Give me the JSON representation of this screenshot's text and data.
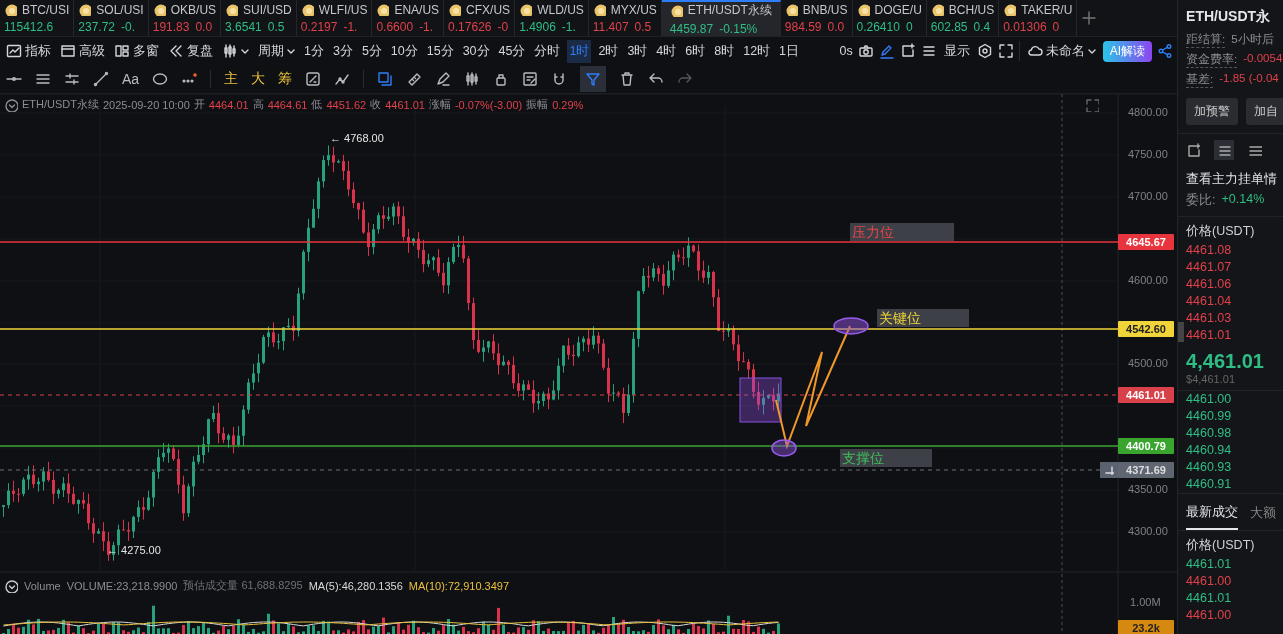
{
  "tickers": [
    {
      "symbol": "BTC/USI",
      "price": "115412.6",
      "up": true,
      "selected": false
    },
    {
      "symbol": "SOL/USI",
      "price": "237.72",
      "change": "-0.",
      "up": true,
      "selected": false
    },
    {
      "symbol": "OKB/US",
      "price": "191.83",
      "change": "0.0",
      "up": false,
      "selected": false
    },
    {
      "symbol": "SUI/USD",
      "price": "3.6541",
      "change": "0.5",
      "up": true,
      "selected": false
    },
    {
      "symbol": "WLFI/US",
      "price": "0.2197",
      "change": "-1.",
      "up": false,
      "selected": false
    },
    {
      "symbol": "ENA/US",
      "price": "0.6600",
      "change": "-1.",
      "up": false,
      "selected": false
    },
    {
      "symbol": "CFX/US",
      "price": "0.17626",
      "change": "-0",
      "up": false,
      "selected": false
    },
    {
      "symbol": "WLD/US",
      "price": "1.4906",
      "change": "-1.",
      "up": true,
      "selected": false
    },
    {
      "symbol": "MYX/US",
      "price": "11.407",
      "change": "0.5",
      "up": false,
      "selected": false
    },
    {
      "symbol": "ETH/USDT永续",
      "price": "4459.87",
      "change": "-0.15%",
      "up": true,
      "selected": true
    },
    {
      "symbol": "BNB/US",
      "price": "984.59",
      "change": "0.0",
      "up": false,
      "selected": false
    },
    {
      "symbol": "DOGE/U",
      "price": "0.26410",
      "change": "0",
      "up": true,
      "selected": false
    },
    {
      "symbol": "BCH/US",
      "price": "602.85",
      "change": "0.4",
      "up": true,
      "selected": false
    },
    {
      "symbol": "TAKER/U",
      "price": "0.01306",
      "change": "0",
      "up": false,
      "selected": false
    }
  ],
  "toolbar": {
    "tools": [
      "指标",
      "高级",
      "多窗",
      "复盘"
    ],
    "period_label": "周期",
    "intervals": [
      {
        "label": "1分",
        "selected": false
      },
      {
        "label": "3分",
        "selected": false
      },
      {
        "label": "5分",
        "selected": false
      },
      {
        "label": "10分",
        "selected": false
      },
      {
        "label": "15分",
        "selected": false
      },
      {
        "label": "30分",
        "selected": false
      },
      {
        "label": "45分",
        "selected": false
      },
      {
        "label": "分时",
        "selected": false
      },
      {
        "label": "1时",
        "selected": true
      },
      {
        "label": "2时",
        "selected": false
      },
      {
        "label": "3时",
        "selected": false
      },
      {
        "label": "4时",
        "selected": false
      },
      {
        "label": "6时",
        "selected": false
      },
      {
        "label": "8时",
        "selected": false
      },
      {
        "label": "12时",
        "selected": false
      },
      {
        "label": "1日",
        "selected": false
      }
    ],
    "countdown": "0s",
    "display_label": "显示",
    "layout_name": "未命名",
    "ai_button": "AI解读"
  },
  "draw_toolbar": {
    "text_tool": "Aa",
    "indicator_buttons": [
      "主",
      "大",
      "筹"
    ],
    "tools": [
      {
        "selected": false
      },
      {
        "selected": false
      },
      {
        "selected": false
      },
      {
        "selected": false
      },
      {
        "selected": false
      },
      {
        "selected": false
      },
      {
        "selected": false
      },
      {
        "selected": true
      },
      {
        "selected": false
      },
      {
        "selected": false
      },
      {
        "selected": false
      }
    ]
  },
  "info": {
    "symbol": "ETH/USDT永续",
    "time": "2025-09-20 10:00",
    "negative": true,
    "fields": [
      {
        "label": "开",
        "value": "4464.01"
      },
      {
        "label": "高",
        "value": "4464.61"
      },
      {
        "label": "低",
        "value": "4451.62"
      },
      {
        "label": "收",
        "value": "4461.01"
      },
      {
        "label": "涨幅",
        "value": "-0.07%(-3.00)"
      },
      {
        "label": "振幅",
        "value": "0.29%"
      }
    ]
  },
  "chart": {
    "y_ticks": [
      "4800.00",
      "4750.00",
      "4700.00",
      "4600.00",
      "4500.00",
      "4350.00",
      "4300.00"
    ],
    "high_label": "← 4768.00",
    "low_label": "← 4275.00",
    "zones": [
      {
        "label": "压力位",
        "kind": "resistance"
      },
      {
        "label": "关键位",
        "kind": "key"
      },
      {
        "label": "支撑位",
        "kind": "support"
      }
    ],
    "price_tags": [
      {
        "value": "4645.67",
        "kind": "resistance"
      },
      {
        "value": "4542.60",
        "kind": "key"
      },
      {
        "value": "4461.01",
        "kind": "last"
      },
      {
        "value": "4400.79",
        "kind": "support"
      },
      {
        "value": "4371.69",
        "kind": "cursor"
      }
    ]
  },
  "volume": {
    "legend": [
      {
        "text": "Volume",
        "color": "#8a8d93"
      },
      {
        "text": "VOLUME:23,218.9900",
        "color": "#8a8d93"
      },
      {
        "text": "预估成交量 61,688.8295",
        "color": "#6d7076"
      },
      {
        "text": "MA(5):46,280.1356",
        "color": "#d8d8d8"
      },
      {
        "text": "MA(10):72,910.3497",
        "color": "#e8c23a"
      }
    ],
    "axis_label": "1.00M",
    "volume_tag": "23.2k"
  },
  "side_panel": {
    "title": "ETH/USDT永",
    "stats": [
      {
        "label": "距结算:",
        "value": "5小时后",
        "negative": false
      },
      {
        "label": "资金费率:",
        "value": "-0.0054",
        "negative": true
      },
      {
        "label": "基差:",
        "value": "-1.85 (-0.04",
        "negative": true
      }
    ],
    "buttons": [
      "加预警",
      "加自"
    ],
    "view_modes": [
      {
        "selected": false
      },
      {
        "selected": true
      },
      {
        "selected": false
      }
    ],
    "depth_title": "查看主力挂单情",
    "ratio_label": "委比:",
    "ratio_value": "+0.14%",
    "price_header": "价格(USDT)",
    "asks": [
      "4461.08",
      "4461.07",
      "4461.06",
      "4461.04",
      "4461.03",
      "4461.01"
    ],
    "mid_price": "4,461.01",
    "mid_fiat": "$4,461.01",
    "bids": [
      "4461.00",
      "4460.99",
      "4460.98",
      "4460.94",
      "4460.93",
      "4460.91"
    ],
    "trade_tabs": [
      {
        "label": "最新成交",
        "selected": true
      },
      {
        "label": "大额",
        "selected": false
      }
    ],
    "trades_header": "价格(USDT)",
    "trades": [
      {
        "price": "4461.01",
        "up": true
      },
      {
        "price": "4461.00",
        "up": false
      },
      {
        "price": "4461.01",
        "up": true
      },
      {
        "price": "4461.00",
        "up": false
      }
    ]
  }
}
